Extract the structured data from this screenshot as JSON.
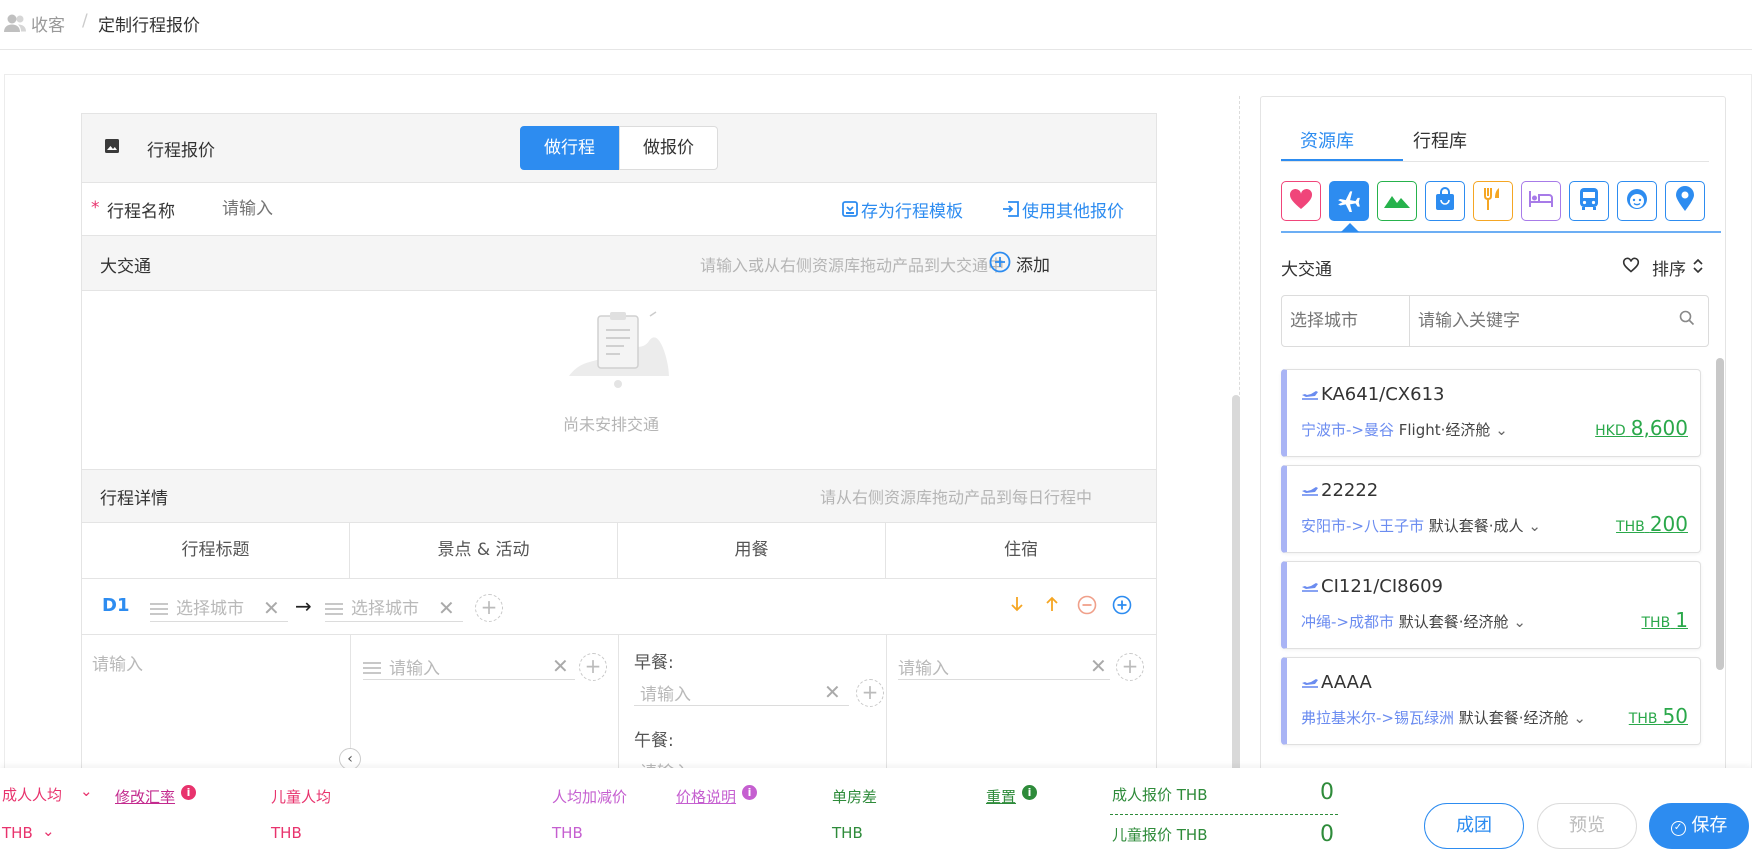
{
  "breadcrumb": {
    "home": "收客",
    "separator": "/",
    "current": "定制行程报价"
  },
  "section_header": {
    "title": "行程报价",
    "tab_itinerary": "做行程",
    "tab_quote": "做报价"
  },
  "name_row": {
    "required_mark": "*",
    "label": "行程名称",
    "placeholder": "请输入",
    "save_template": "存为行程模板",
    "use_other": "使用其他报价"
  },
  "transport": {
    "label": "大交通",
    "hint": "请输入或从右侧资源库拖动产品到大交通中",
    "add": "添加",
    "empty": "尚未安排交通"
  },
  "details": {
    "label": "行程详情",
    "hint": "请从右侧资源库拖动产品到每日行程中",
    "columns": [
      "行程标题",
      "景点 & 活动",
      "用餐",
      "住宿"
    ],
    "day": "D1",
    "city_placeholder_from": "选择城市",
    "city_placeholder_to": "选择城市",
    "arrow": "→",
    "title_placeholder": "请输入",
    "activity_placeholder": "请输入",
    "breakfast_label": "早餐:",
    "breakfast_placeholder": "请输入",
    "lunch_label": "午餐:",
    "lunch_placeholder": "请输入",
    "hotel_placeholder": "请输入"
  },
  "right_panel": {
    "tabs": [
      "资源库",
      "行程库"
    ],
    "category_icons": [
      "heart-icon",
      "plane-icon",
      "mountain-icon",
      "shopping-bag-icon",
      "fork-knife-icon",
      "bed-icon",
      "bus-icon",
      "guide-face-icon",
      "location-pin-icon"
    ],
    "category_colors": [
      "#f0457a",
      "#2d8cf0",
      "#26b24c",
      "#2d8cf0",
      "#f5a623",
      "#a77be8",
      "#2d8cf0",
      "#2d8cf0",
      "#2d8cf0"
    ],
    "section_title": "大交通",
    "sort_label": "排序",
    "city_placeholder": "选择城市",
    "keyword_placeholder": "请输入关键字",
    "items": [
      {
        "code": "KA641/CX613",
        "route": "宁波市->曼谷",
        "package": "Flight·经济舱",
        "currency": "HKD",
        "price": "8,600"
      },
      {
        "code": "22222",
        "route": "安阳市->八王子市",
        "package": "默认套餐·成人",
        "currency": "THB",
        "price": "200"
      },
      {
        "code": "CI121/CI8609",
        "route": "冲绳->成都市",
        "package": "默认套餐·经济舱",
        "currency": "THB",
        "price": "1"
      },
      {
        "code": "AAAA",
        "route": "弗拉基米尔->锡瓦绿洲",
        "package": "默认套餐·经济舱",
        "currency": "THB",
        "price": "50"
      }
    ]
  },
  "bottom_bar": {
    "adult_avg": "成人人均",
    "modify_rate": "修改汇率",
    "child_avg": "儿童人均",
    "avg_adjust": "人均加减价",
    "price_note": "价格说明",
    "single_room": "单房差",
    "reset": "重置",
    "adult_quote": "成人报价 THB",
    "child_quote": "儿童报价 THB",
    "adult_quote_value": "0",
    "child_quote_value": "0",
    "currency_adult": "THB",
    "currency_child": "THB",
    "currency_adjust": "THB",
    "currency_single": "THB",
    "btn_group": "成团",
    "btn_preview": "预览",
    "btn_save": "保存"
  }
}
